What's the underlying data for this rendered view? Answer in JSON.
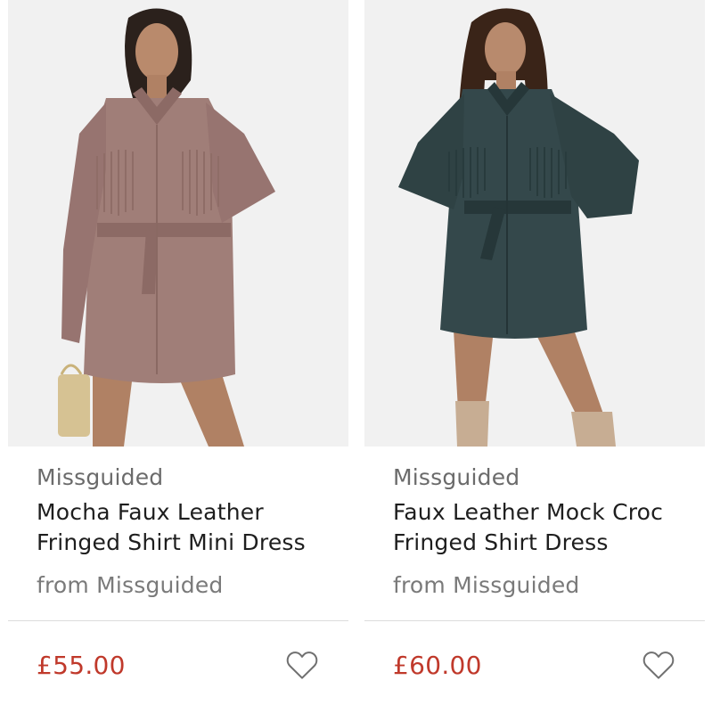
{
  "products": [
    {
      "brand": "Missguided",
      "title_line1": "Mocha Faux Leather",
      "title_line2": "Fringed Shirt Mini Dress",
      "source": "from Missguided",
      "price": "£55.00",
      "dress_color": "#a07e78",
      "image_icon": "product-photo"
    },
    {
      "brand": "Missguided",
      "title_line1": "Faux Leather Mock Croc",
      "title_line2": "Fringed Shirt Dress",
      "source": "from Missguided",
      "price": "£60.00",
      "dress_color": "#34484b",
      "image_icon": "product-photo"
    }
  ],
  "colors": {
    "price": "#c0392b",
    "image_background": "#f1f1f1",
    "divider": "#dcdcdc"
  }
}
